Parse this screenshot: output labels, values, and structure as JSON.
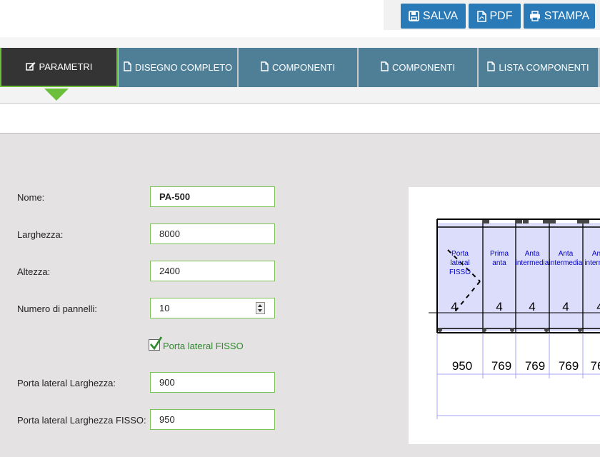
{
  "toolbar": {
    "save_label": "SALVA",
    "pdf_label": "PDF",
    "print_label": "STAMPA"
  },
  "tabs": [
    {
      "label": "PARAMETRI",
      "icon": "edit-icon",
      "active": true
    },
    {
      "label": "DISEGNO COMPLETO",
      "icon": "file-icon",
      "active": false
    },
    {
      "label": "COMPONENTI",
      "icon": "file-icon",
      "active": false
    },
    {
      "label": "COMPONENTI",
      "icon": "file-icon",
      "active": false
    },
    {
      "label": "LISTA COMPONENTI",
      "icon": "file-icon",
      "active": false
    }
  ],
  "form": {
    "nome": {
      "label": "Nome:",
      "value": "PA-500"
    },
    "larghezza": {
      "label": "Larghezza:",
      "value": "8000"
    },
    "altezza": {
      "label": "Altezza:",
      "value": "2400"
    },
    "pannelli": {
      "label": "Numero di pannelli:",
      "value": "10"
    },
    "porta_fisso": {
      "label": "Porta lateral FISSO",
      "checked": true
    },
    "porta_larghezza": {
      "label": "Porta lateral Larghezza:",
      "value": "900"
    },
    "porta_larghezza_fisso": {
      "label": "Porta lateral Larghezza FISSO:",
      "value": "950"
    }
  },
  "drawing": {
    "panels": [
      {
        "label_lines": [
          "Porta",
          "lateral",
          "FISSO"
        ],
        "count": "4",
        "width": "950"
      },
      {
        "label_lines": [
          "Prima",
          "anta"
        ],
        "count": "4",
        "width": "769"
      },
      {
        "label_lines": [
          "Anta",
          "intermedia"
        ],
        "count": "4",
        "width": "769"
      },
      {
        "label_lines": [
          "Anta",
          "intermedia"
        ],
        "count": "4",
        "width": "769"
      },
      {
        "label_lines": [
          "An",
          "interme"
        ],
        "count": "4",
        "width": "76"
      }
    ]
  },
  "colors": {
    "primary_button": "#2a7ab8",
    "tab": "#4f7f96",
    "tab_active": "#343434",
    "accent": "#6cbf3b",
    "panel_fill": "#dcdcfb",
    "panel_text": "#0000c8"
  }
}
